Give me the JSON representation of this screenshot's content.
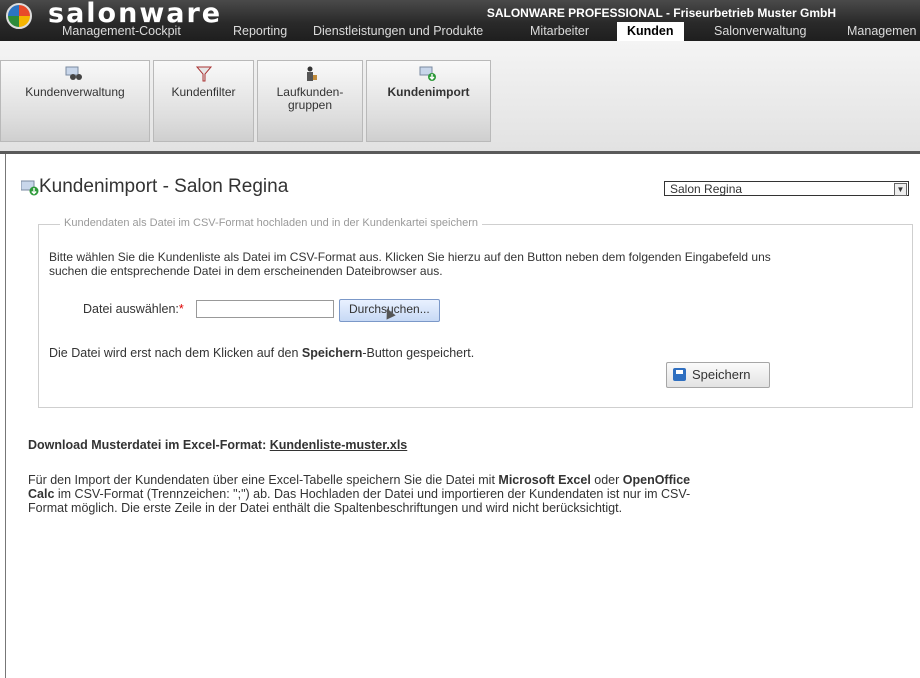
{
  "app": {
    "logo": "salonware",
    "company": "SALONWARE PROFESSIONAL - Friseurbetrieb Muster GmbH"
  },
  "mainnav": [
    {
      "label": "Management-Cockpit"
    },
    {
      "label": "Reporting"
    },
    {
      "label": "Dienstleistungen und Produkte"
    },
    {
      "label": "Mitarbeiter"
    },
    {
      "label": "Kunden"
    },
    {
      "label": "Salonverwaltung"
    },
    {
      "label": "Managemen"
    }
  ],
  "subnav": [
    {
      "label": "Kundenverwaltung"
    },
    {
      "label": "Kundenfilter"
    },
    {
      "label": "Laufkunden-\ngruppen"
    },
    {
      "label": "Kundenimport"
    }
  ],
  "page": {
    "title": "Kundenimport - Salon Regina",
    "salon_select": "Salon Regina"
  },
  "upload": {
    "legend": "Kundendaten als Datei im CSV-Format hochladen und in der Kundenkartei speichern",
    "instructions": "Bitte wählen Sie die Kundenliste als Datei im CSV-Format aus. Klicken Sie hierzu auf den Button neben dem folgenden Eingabefeld uns suchen die entsprechende Datei in dem erscheinenden Dateibrowser aus.",
    "file_label": "Datei auswählen:",
    "required_mark": "*",
    "browse_button": "Durchsuchen...",
    "note_before": "Die Datei wird erst nach dem Klicken auf den ",
    "note_bold": "Speichern",
    "note_after": "-Button gespeichert.",
    "save_button": "Speichern"
  },
  "download": {
    "label": "Download Musterdatei im Excel-Format: ",
    "link": "Kundenliste-muster.xls"
  },
  "info": {
    "t1": "Für den Import der Kundendaten über eine Excel-Tabelle speichern Sie die Datei mit ",
    "b1": "Microsoft Excel",
    "t2": " oder ",
    "b2": "OpenOffice Calc",
    "t3": " im CSV-Format (Trennzeichen: \";\") ab. Das Hochladen der Datei und importieren der Kundendaten ist nur im CSV-Format möglich. Die erste Zeile in der Datei enthält die Spaltenbeschriftungen und wird nicht berücksichtigt."
  },
  "colors": {
    "header_bg": "#2a2a2a",
    "legend_text": "#9a9a9a",
    "required": "#dd0000",
    "accent_blue": "#2f6fc0"
  }
}
